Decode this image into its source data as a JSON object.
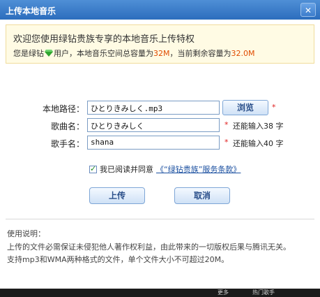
{
  "window": {
    "title": "上传本地音乐",
    "close_glyph": "✕"
  },
  "notice": {
    "line1": "欢迎您使用绿钻贵族专享的本地音乐上传特权",
    "line2_prefix": "您是绿钻",
    "line2_suffix": "用户，本地音乐空间总容量为",
    "total_capacity": "32M",
    "remaining_label": "，当前剩余容量为",
    "remaining_capacity": "32.0M"
  },
  "form": {
    "path_label": "本地路径：",
    "path_value": "ひとりきみしく.mp3",
    "browse_label": "浏览",
    "song_label": "歌曲名：",
    "song_value": "ひとりきみしく",
    "song_hint": "还能输入38 字",
    "singer_label": "歌手名：",
    "singer_value": "shana",
    "singer_hint": "还能输入40 字",
    "required_mark": "*"
  },
  "agreement": {
    "prefix": "我已阅读并同意",
    "link": "《“绿钻贵族”服务条款》",
    "checked": true
  },
  "buttons": {
    "upload": "上传",
    "cancel": "取消"
  },
  "usage": {
    "heading": "使用说明：",
    "line1": "上传的文件必需保证未侵犯他人著作权利益，由此带来的一切版权后果与腾讯无关。",
    "line2": "支持mp3和WMA两种格式的文件，单个文件大小不可超过20M。"
  },
  "background": {
    "text_a": "更多",
    "text_b": "热门歌手"
  },
  "colors": {
    "titlebar": "#2c6dbd",
    "highlight": "#e04b00",
    "required": "#e02020",
    "link": "#1a4fa0"
  }
}
